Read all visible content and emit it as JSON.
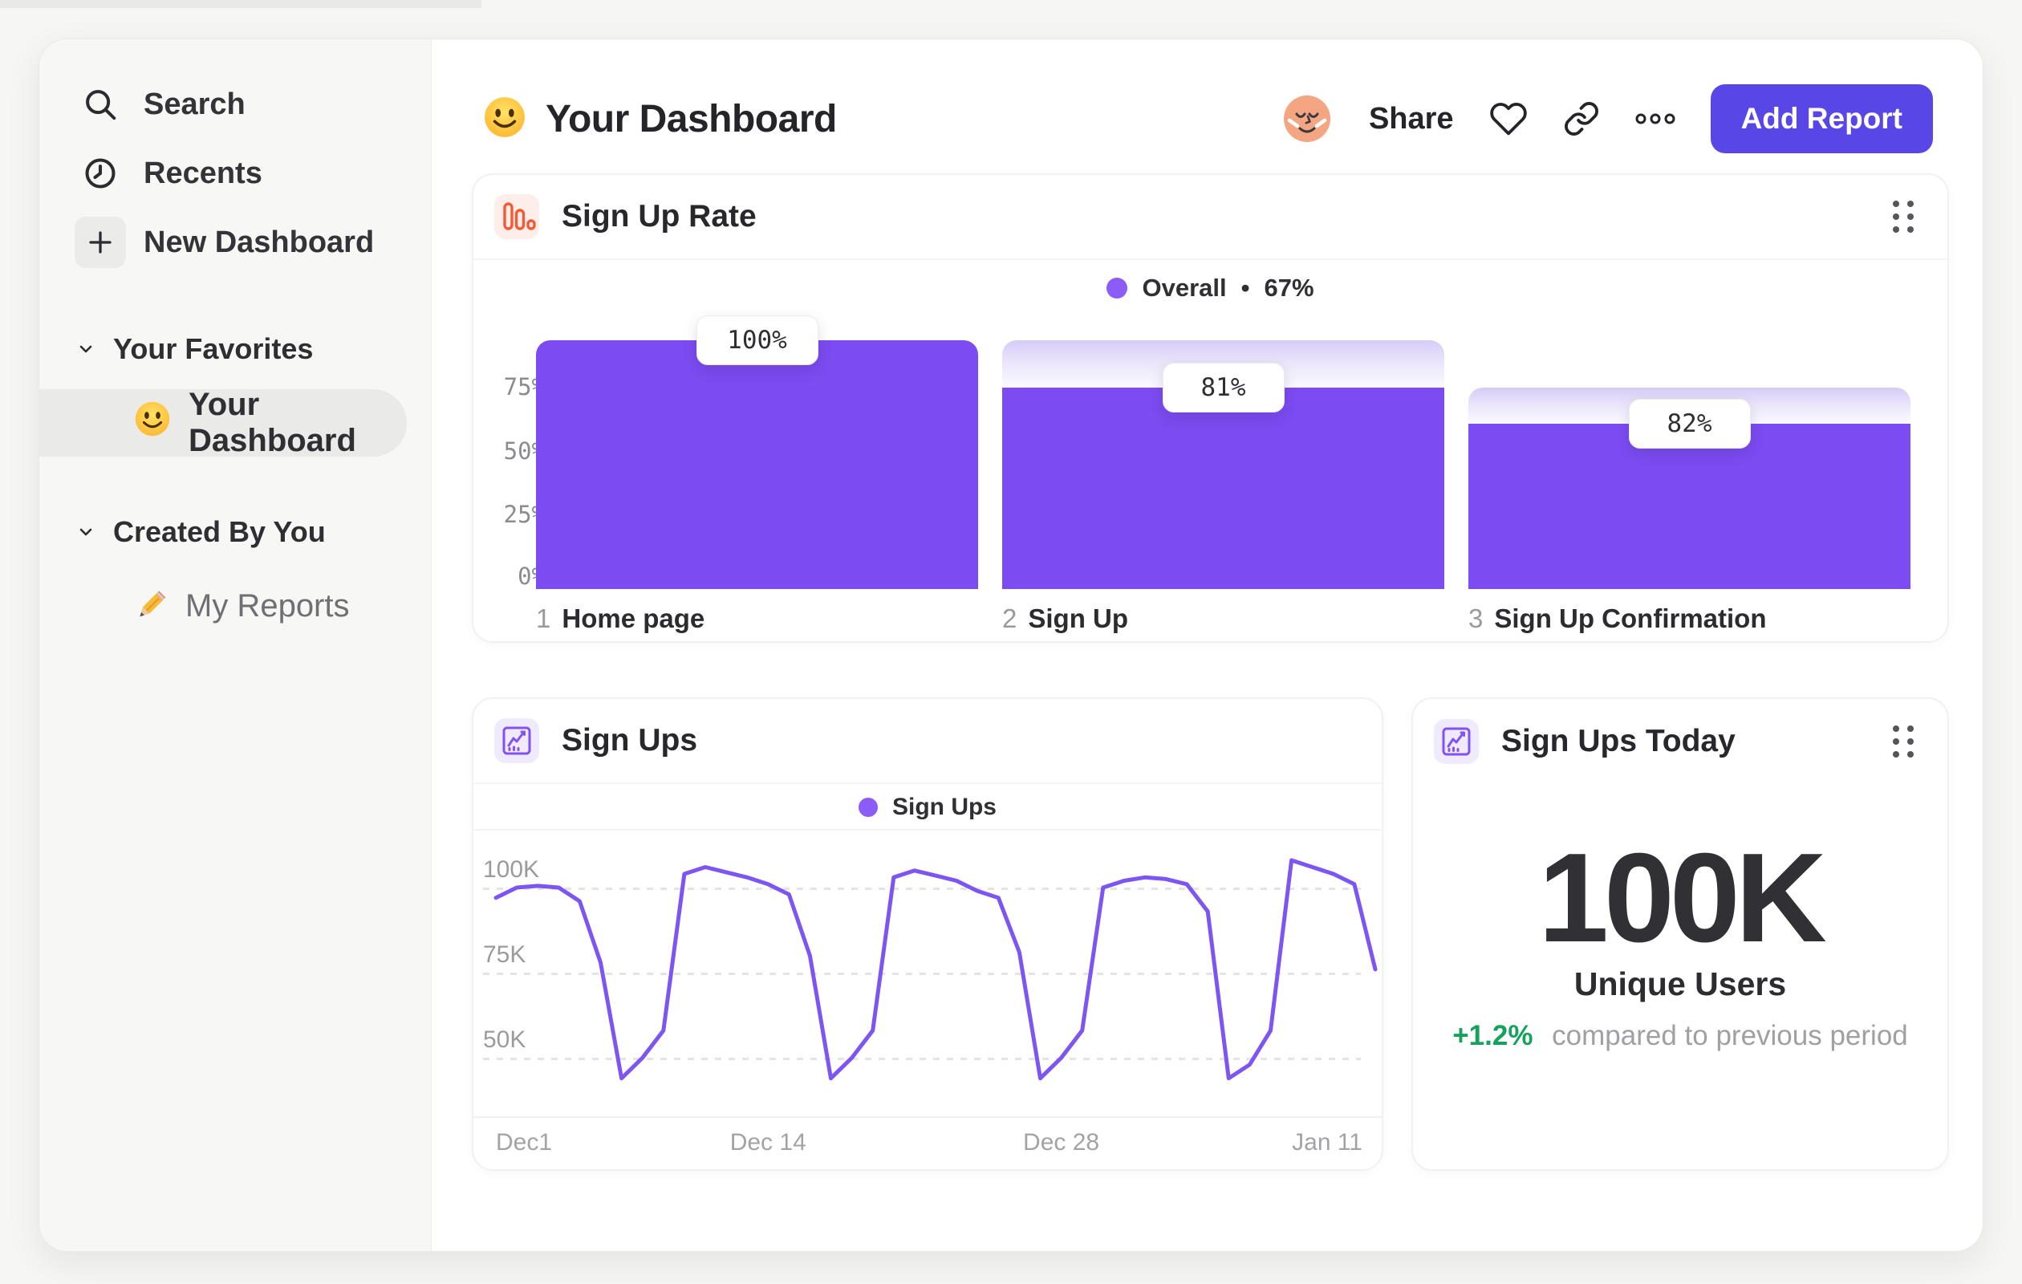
{
  "header": {
    "title": "Your Dashboard",
    "share": "Share",
    "add_report": "Add Report"
  },
  "sidebar": {
    "search": "Search",
    "recents": "Recents",
    "new_dashboard": "New Dashboard",
    "favorites_header": "Your Favorites",
    "favorite_item": "Your Dashboard",
    "created_header": "Created By You",
    "created_item": "My Reports"
  },
  "cards": {
    "signup_rate": {
      "title": "Sign Up Rate"
    },
    "signups": {
      "title": "Sign Ups"
    },
    "signups_today": {
      "title": "Sign Ups Today",
      "value": "100K",
      "label": "Unique Users",
      "delta": "+1.2%",
      "delta_caption": "compared to previous period"
    }
  },
  "chart_data": [
    {
      "type": "bar",
      "title": "Sign Up Rate",
      "legend": {
        "name": "Overall",
        "separator": "•",
        "value": "67%"
      },
      "categories": [
        "Home page",
        "Sign Up",
        "Sign Up Confirmation"
      ],
      "category_indices": [
        "1",
        "2",
        "3"
      ],
      "values": [
        100,
        81,
        82
      ],
      "value_labels": [
        "100%",
        "81%",
        "82%"
      ],
      "bar_total_pct": [
        100,
        100,
        81
      ],
      "bar_solid_pct": [
        100,
        81,
        66.4
      ],
      "yticks": [
        "75%",
        "50%",
        "25%",
        "0%"
      ],
      "ylim": [
        0,
        100
      ],
      "grid": false,
      "colors": {
        "bar": "#7c4bf2",
        "gradient_top": "#d5ccf6"
      }
    },
    {
      "type": "line",
      "title": "Sign Ups",
      "legend": "Sign Ups",
      "unit": "K",
      "yticks": [
        {
          "label": "100K",
          "value": 100
        },
        {
          "label": "75K",
          "value": 75
        },
        {
          "label": "50K",
          "value": 50
        }
      ],
      "xticks": [
        {
          "label": "Dec1",
          "day": 0
        },
        {
          "label": "Dec 14",
          "day": 13
        },
        {
          "label": "Dec 28",
          "day": 27
        },
        {
          "label": "Jan 11",
          "day": 41
        }
      ],
      "values": [
        97,
        100,
        100.5,
        100,
        96,
        78,
        44,
        50,
        58,
        104,
        106,
        104.5,
        103,
        101,
        98,
        80,
        44,
        50,
        58,
        103,
        105,
        103.5,
        102,
        99,
        97,
        81,
        44,
        50,
        58,
        100,
        102,
        103,
        102.5,
        101,
        93,
        44,
        48,
        58,
        108,
        106,
        104,
        101,
        76
      ],
      "grid": "dashed-horizontal",
      "legend_position": "top-center",
      "colors": {
        "line": "#7d55f3",
        "legend_dot": "#8b5cf6"
      }
    }
  ],
  "colors": {
    "accent_purple": "#7c4bf2",
    "button_purple": "#5847e6",
    "positive_green": "#16a15c",
    "icon_orange": "#f25b35",
    "icon_purple": "#8352f5",
    "avatar_peach": "#f4a581"
  }
}
